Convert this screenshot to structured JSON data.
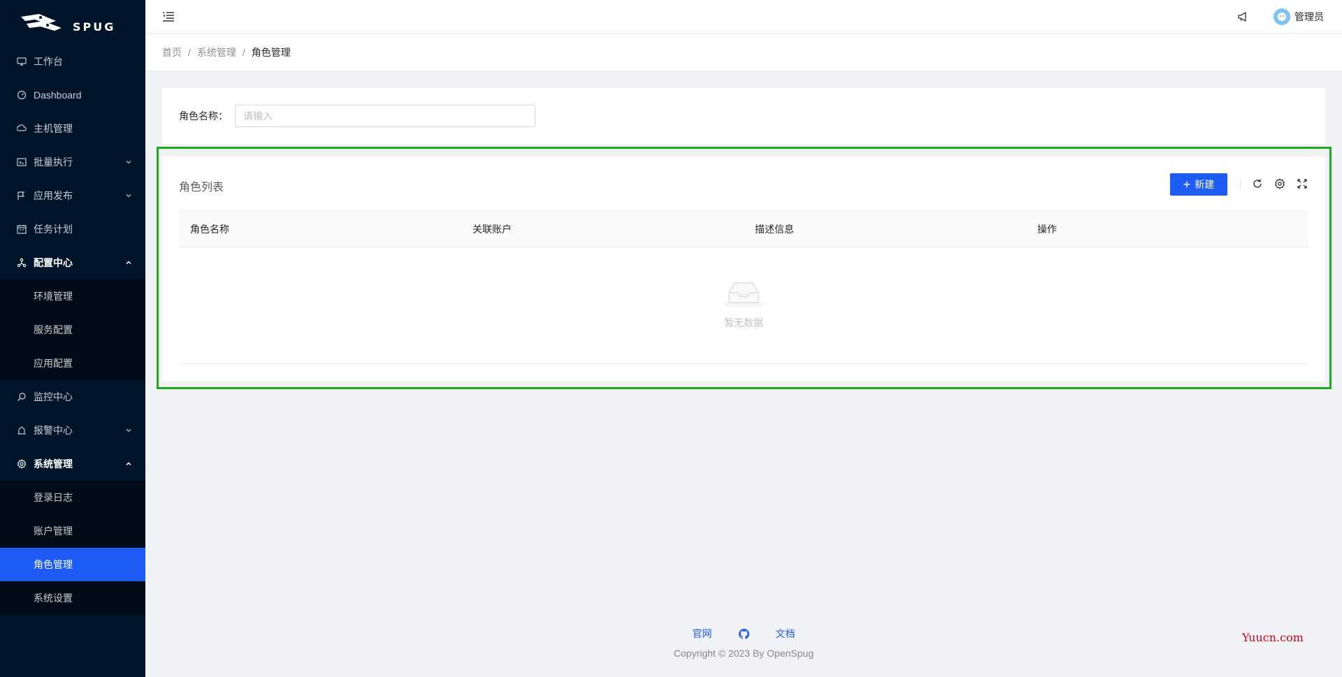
{
  "brand": {
    "logo_text": "SPUG"
  },
  "sidebar": {
    "items": [
      {
        "label": "工作台",
        "icon": "desktop-icon"
      },
      {
        "label": "Dashboard",
        "icon": "dashboard-icon"
      },
      {
        "label": "主机管理",
        "icon": "cloud-server-icon"
      },
      {
        "label": "批量执行",
        "icon": "code-icon",
        "expandable": true
      },
      {
        "label": "应用发布",
        "icon": "flag-icon",
        "expandable": true
      },
      {
        "label": "任务计划",
        "icon": "schedule-icon"
      },
      {
        "label": "配置中心",
        "icon": "deployment-unit-icon",
        "open": true,
        "children": [
          "环境管理",
          "服务配置",
          "应用配置"
        ]
      },
      {
        "label": "监控中心",
        "icon": "monitor-icon"
      },
      {
        "label": "报警中心",
        "icon": "alert-icon",
        "expandable": true
      },
      {
        "label": "系统管理",
        "icon": "setting-icon",
        "open": true,
        "children": [
          "登录日志",
          "账户管理",
          "角色管理",
          "系统设置"
        ]
      }
    ],
    "active": "角色管理"
  },
  "header": {
    "username": "管理员"
  },
  "breadcrumb": [
    "首页",
    "系统管理",
    "角色管理"
  ],
  "search": {
    "label": "角色名称：",
    "placeholder": "请输入",
    "value": ""
  },
  "table": {
    "title": "角色列表",
    "new_button": "新建",
    "columns": [
      "角色名称",
      "关联账户",
      "描述信息",
      "操作"
    ],
    "empty_text": "暂无数据"
  },
  "footer": {
    "links": [
      "官网",
      "文档"
    ],
    "copyright": "Copyright © 2023 By OpenSpug"
  },
  "watermark": "Yuucn.com",
  "colors": {
    "primary": "#1d5cf5",
    "sider": "#001529",
    "frame": "#1aad19"
  }
}
